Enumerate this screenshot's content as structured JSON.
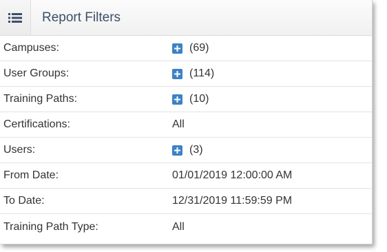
{
  "header": {
    "icon": "list-icon",
    "title": "Report Filters"
  },
  "filters": [
    {
      "label": "Campuses:",
      "value": "(69)",
      "expandable": true
    },
    {
      "label": "User Groups:",
      "value": "(114)",
      "expandable": true
    },
    {
      "label": "Training Paths:",
      "value": "(10)",
      "expandable": true
    },
    {
      "label": "Certifications:",
      "value": "All",
      "expandable": false
    },
    {
      "label": "Users:",
      "value": "(3)",
      "expandable": true
    },
    {
      "label": "From Date:",
      "value": "01/01/2019 12:00:00 AM",
      "expandable": false
    },
    {
      "label": "To Date:",
      "value": "12/31/2019 11:59:59 PM",
      "expandable": false
    },
    {
      "label": "Training Path Type:",
      "value": "All",
      "expandable": false
    }
  ],
  "colors": {
    "accent": "#3d82c4",
    "title": "#3b4f66",
    "text": "#333333"
  }
}
